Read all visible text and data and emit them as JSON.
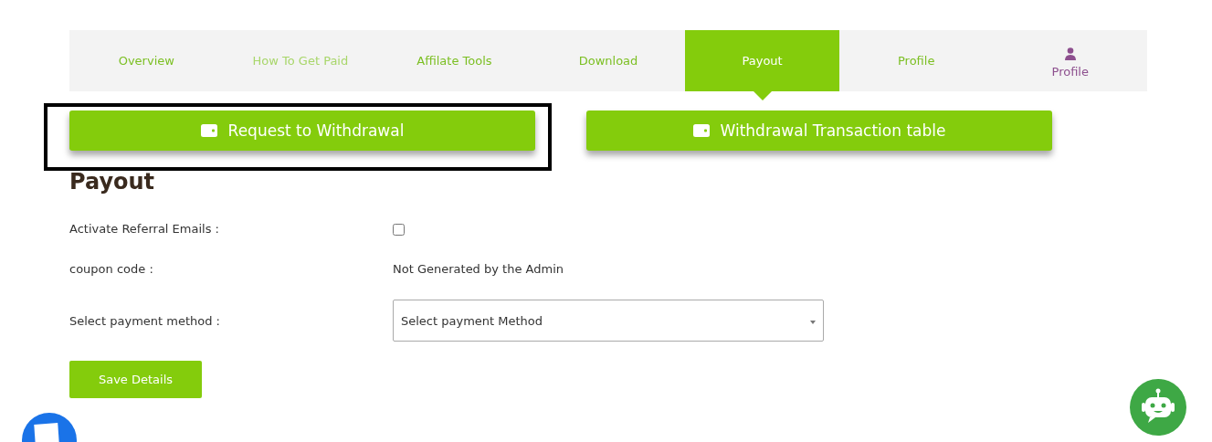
{
  "tabs": [
    {
      "label": "Overview",
      "selected": false,
      "muted": false,
      "icon": false
    },
    {
      "label": "How To Get Paid",
      "selected": false,
      "muted": true,
      "icon": false
    },
    {
      "label": "Affilate Tools",
      "selected": false,
      "muted": false,
      "icon": false
    },
    {
      "label": "Download",
      "selected": false,
      "muted": false,
      "icon": false
    },
    {
      "label": "Payout",
      "selected": true,
      "muted": false,
      "icon": false
    },
    {
      "label": "Profile",
      "selected": false,
      "muted": false,
      "icon": false
    },
    {
      "label": "Profile",
      "selected": false,
      "muted": false,
      "icon": true
    }
  ],
  "actions": [
    {
      "label": "Request to Withdrawal",
      "highlighted": true
    },
    {
      "label": "Withdrawal Transaction table",
      "highlighted": false
    }
  ],
  "heading": "Payout",
  "fields": [
    {
      "kind": "checkbox",
      "label": "Activate Referral Emails :",
      "checked": false
    },
    {
      "kind": "text",
      "label": "coupon code :",
      "value": "Not Generated by the Admin"
    },
    {
      "kind": "select",
      "label": "Select payment method :",
      "placeholder": "Select payment Method"
    }
  ],
  "save_button": "Save Details"
}
